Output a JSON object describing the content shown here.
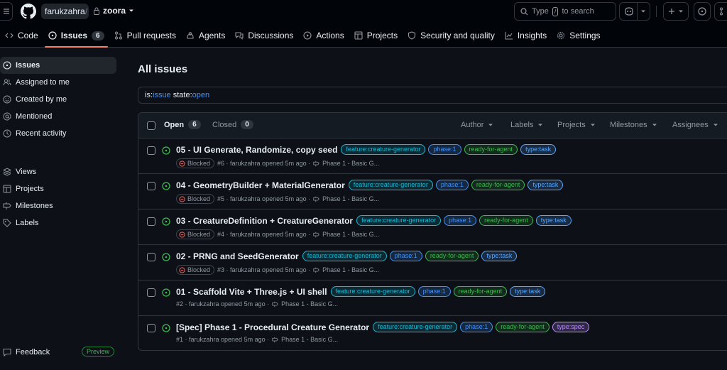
{
  "header": {
    "owner": "farukzahra",
    "slash": "/",
    "repo": "zoora",
    "search": {
      "prefix": "Type",
      "key": "/",
      "suffix": "to search"
    }
  },
  "repo_nav": [
    {
      "label": "Code",
      "icon": "code-icon"
    },
    {
      "label": "Issues",
      "icon": "issue-opened-icon",
      "count": "6",
      "active": true
    },
    {
      "label": "Pull requests",
      "icon": "pull-request-icon"
    },
    {
      "label": "Agents",
      "icon": "agent-icon"
    },
    {
      "label": "Discussions",
      "icon": "discussion-icon"
    },
    {
      "label": "Actions",
      "icon": "play-icon"
    },
    {
      "label": "Projects",
      "icon": "table-icon"
    },
    {
      "label": "Security and quality",
      "icon": "shield-icon"
    },
    {
      "label": "Insights",
      "icon": "graph-icon"
    },
    {
      "label": "Settings",
      "icon": "gear-icon"
    }
  ],
  "sidebar": {
    "items": [
      {
        "label": "Issues",
        "icon": "issue-opened-icon",
        "active": true
      },
      {
        "label": "Assigned to me",
        "icon": "people-icon"
      },
      {
        "label": "Created by me",
        "icon": "smiley-icon"
      },
      {
        "label": "Mentioned",
        "icon": "mention-icon"
      },
      {
        "label": "Recent activity",
        "icon": "clock-icon"
      }
    ],
    "items2": [
      {
        "label": "Views",
        "icon": "stack-icon"
      },
      {
        "label": "Projects",
        "icon": "table-icon"
      },
      {
        "label": "Milestones",
        "icon": "milestone-icon"
      },
      {
        "label": "Labels",
        "icon": "tag-icon"
      }
    ],
    "feedback": "Feedback",
    "preview": "Preview"
  },
  "main": {
    "title": "All issues",
    "query": [
      {
        "key": "is:",
        "val": "issue"
      },
      {
        "key": " state:",
        "val": "open"
      }
    ],
    "tabs": {
      "open_label": "Open",
      "open_count": "6",
      "closed_label": "Closed",
      "closed_count": "0"
    },
    "filters": [
      "Author",
      "Labels",
      "Projects",
      "Milestones",
      "Assignees"
    ]
  },
  "colors": {
    "feature": "#1ab8d4",
    "phase": "#4493f8",
    "ready": "#3fb950",
    "task": "#58a6ff",
    "spec": "#bc8cff",
    "open_icon": "#3fb950",
    "blocked_icon": "#f85149"
  },
  "issues": [
    {
      "title": "05 - UI Generate, Randomize, copy seed",
      "blocked": "Blocked",
      "meta": "#6 · farukzahra opened 5m ago ·",
      "milestone": "Phase 1 - Basic G...",
      "labels": [
        {
          "text": "feature:creature-generator",
          "kind": "feature"
        },
        {
          "text": "phase:1",
          "kind": "phase"
        },
        {
          "text": "ready-for-agent",
          "kind": "ready"
        },
        {
          "text": "type:task",
          "kind": "task"
        }
      ]
    },
    {
      "title": "04 - GeometryBuilder + MaterialGenerator",
      "blocked": "Blocked",
      "meta": "#5 · farukzahra opened 5m ago ·",
      "milestone": "Phase 1 - Basic G...",
      "labels": [
        {
          "text": "feature:creature-generator",
          "kind": "feature"
        },
        {
          "text": "phase:1",
          "kind": "phase"
        },
        {
          "text": "ready-for-agent",
          "kind": "ready"
        },
        {
          "text": "type:task",
          "kind": "task"
        }
      ]
    },
    {
      "title": "03 - CreatureDefinition + CreatureGenerator",
      "blocked": "Blocked",
      "meta": "#4 · farukzahra opened 5m ago ·",
      "milestone": "Phase 1 - Basic G...",
      "labels": [
        {
          "text": "feature:creature-generator",
          "kind": "feature"
        },
        {
          "text": "phase:1",
          "kind": "phase"
        },
        {
          "text": "ready-for-agent",
          "kind": "ready"
        },
        {
          "text": "type:task",
          "kind": "task"
        }
      ]
    },
    {
      "title": "02 - PRNG and SeedGenerator",
      "blocked": "Blocked",
      "meta": "#3 · farukzahra opened 5m ago ·",
      "milestone": "Phase 1 - Basic G...",
      "labels": [
        {
          "text": "feature:creature-generator",
          "kind": "feature"
        },
        {
          "text": "phase:1",
          "kind": "phase"
        },
        {
          "text": "ready-for-agent",
          "kind": "ready"
        },
        {
          "text": "type:task",
          "kind": "task"
        }
      ]
    },
    {
      "title": "01 - Scaffold Vite + Three.js + UI shell",
      "blocked": "",
      "meta": "#2 · farukzahra opened 5m ago ·",
      "milestone": "Phase 1 - Basic G...",
      "labels": [
        {
          "text": "feature:creature-generator",
          "kind": "feature"
        },
        {
          "text": "phase:1",
          "kind": "phase"
        },
        {
          "text": "ready-for-agent",
          "kind": "ready"
        },
        {
          "text": "type:task",
          "kind": "task"
        }
      ]
    },
    {
      "title": "[Spec] Phase 1 - Procedural Creature Generator",
      "blocked": "",
      "meta": "#1 · farukzahra opened 5m ago ·",
      "milestone": "Phase 1 - Basic G...",
      "labels": [
        {
          "text": "feature:creature-generator",
          "kind": "feature"
        },
        {
          "text": "phase:1",
          "kind": "phase"
        },
        {
          "text": "ready-for-agent",
          "kind": "ready"
        },
        {
          "text": "type:spec",
          "kind": "spec"
        }
      ]
    }
  ]
}
